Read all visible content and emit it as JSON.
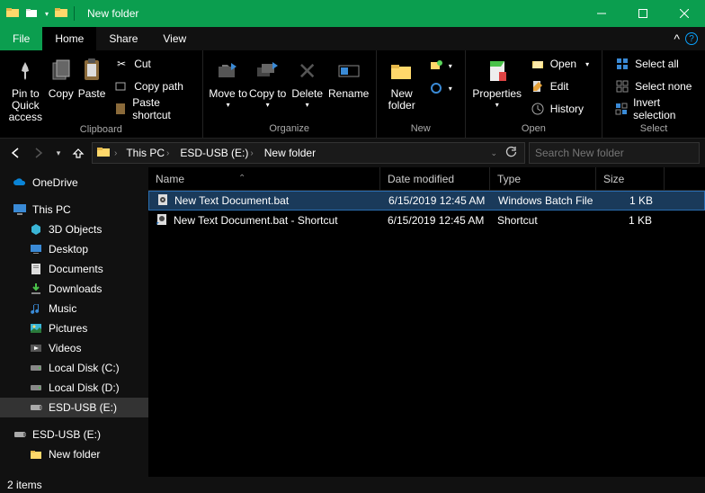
{
  "window": {
    "title": "New folder"
  },
  "tabs": {
    "file": "File",
    "home": "Home",
    "share": "Share",
    "view": "View"
  },
  "ribbon": {
    "pin": "Pin to Quick access",
    "copy": "Copy",
    "paste": "Paste",
    "cut": "Cut",
    "copypath": "Copy path",
    "pasteshortcut": "Paste shortcut",
    "moveto": "Move to",
    "copyto": "Copy to",
    "delete": "Delete",
    "rename": "Rename",
    "newfolder": "New folder",
    "properties": "Properties",
    "open": "Open",
    "edit": "Edit",
    "history": "History",
    "selectall": "Select all",
    "selectnone": "Select none",
    "invert": "Invert selection",
    "groups": {
      "clipboard": "Clipboard",
      "organize": "Organize",
      "new": "New",
      "open": "Open",
      "select": "Select"
    }
  },
  "breadcrumb": {
    "thispc": "This PC",
    "drive": "ESD-USB (E:)",
    "folder": "New folder"
  },
  "search": {
    "placeholder": "Search New folder"
  },
  "sidebar": {
    "onedrive": "OneDrive",
    "thispc": "This PC",
    "objects3d": "3D Objects",
    "desktop": "Desktop",
    "documents": "Documents",
    "downloads": "Downloads",
    "music": "Music",
    "pictures": "Pictures",
    "videos": "Videos",
    "driveC": "Local Disk (C:)",
    "driveD": "Local Disk (D:)",
    "driveE": "ESD-USB (E:)",
    "driveE2": "ESD-USB (E:)",
    "newfolder": "New folder"
  },
  "columns": {
    "name": "Name",
    "date": "Date modified",
    "type": "Type",
    "size": "Size"
  },
  "files": [
    {
      "name": "New Text Document.bat",
      "date": "6/15/2019 12:45 AM",
      "type": "Windows Batch File",
      "size": "1 KB"
    },
    {
      "name": "New Text Document.bat - Shortcut",
      "date": "6/15/2019 12:45 AM",
      "type": "Shortcut",
      "size": "1 KB"
    }
  ],
  "status": "2 items"
}
